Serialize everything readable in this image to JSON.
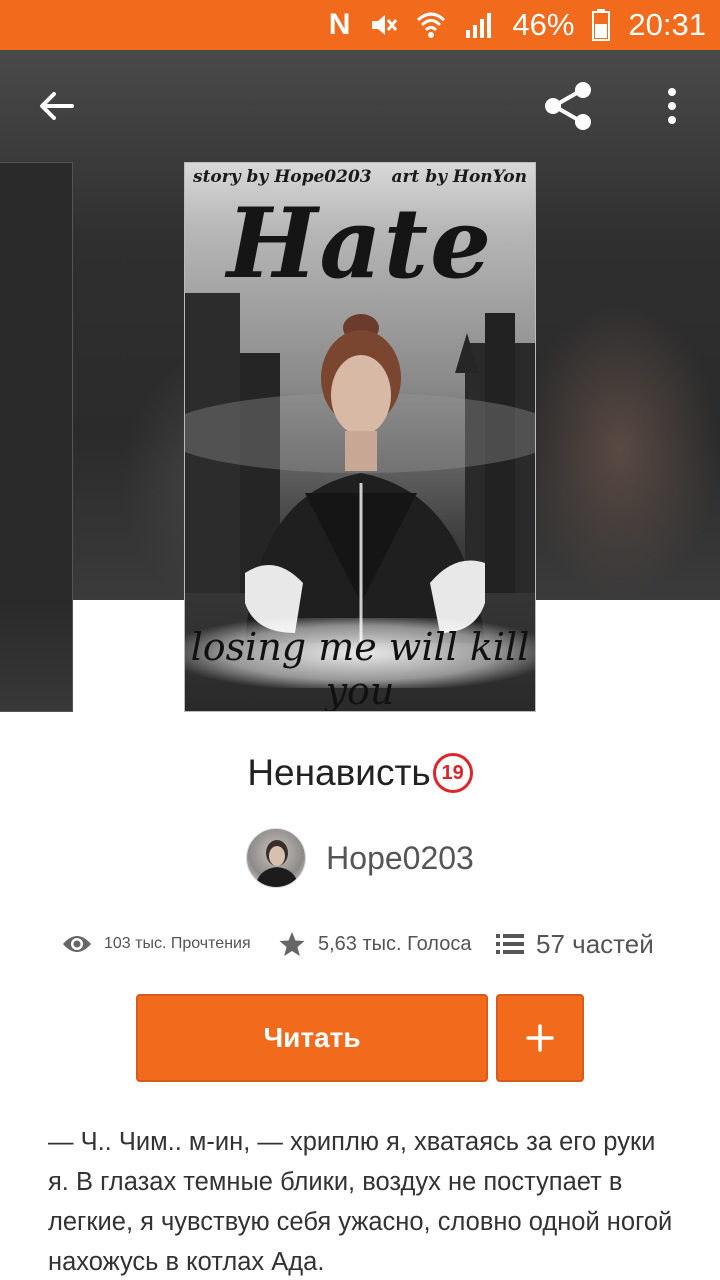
{
  "status_bar": {
    "notification_icon": "N",
    "battery_percent": "46%",
    "time": "20:31",
    "accent_color": "#f26b1d"
  },
  "toolbar": {
    "back_icon": "arrow-left",
    "share_icon": "share",
    "more_icon": "more-vertical"
  },
  "cover": {
    "credit_left": "story by Hope0203",
    "credit_right": "art by HonYon",
    "title": "Hate",
    "tagline": "losing me will kill you"
  },
  "book": {
    "title": "Ненависть",
    "age_rating": "19"
  },
  "author": {
    "name": "Hope0203"
  },
  "stats": {
    "reads": "103 тыс. Прочтения",
    "votes": "5,63 тыс. Голоса",
    "parts": "57 частей"
  },
  "actions": {
    "read_label": "Читать",
    "add_label": "+"
  },
  "description": "— Ч.. Чим.. м-ин, — хриплю я, хватаясь за его руки я. В глазах темные блики, воздух не поступает в легкие, я чувствую себя ужасно, словно одной ногой нахожусь в котлах Ада."
}
